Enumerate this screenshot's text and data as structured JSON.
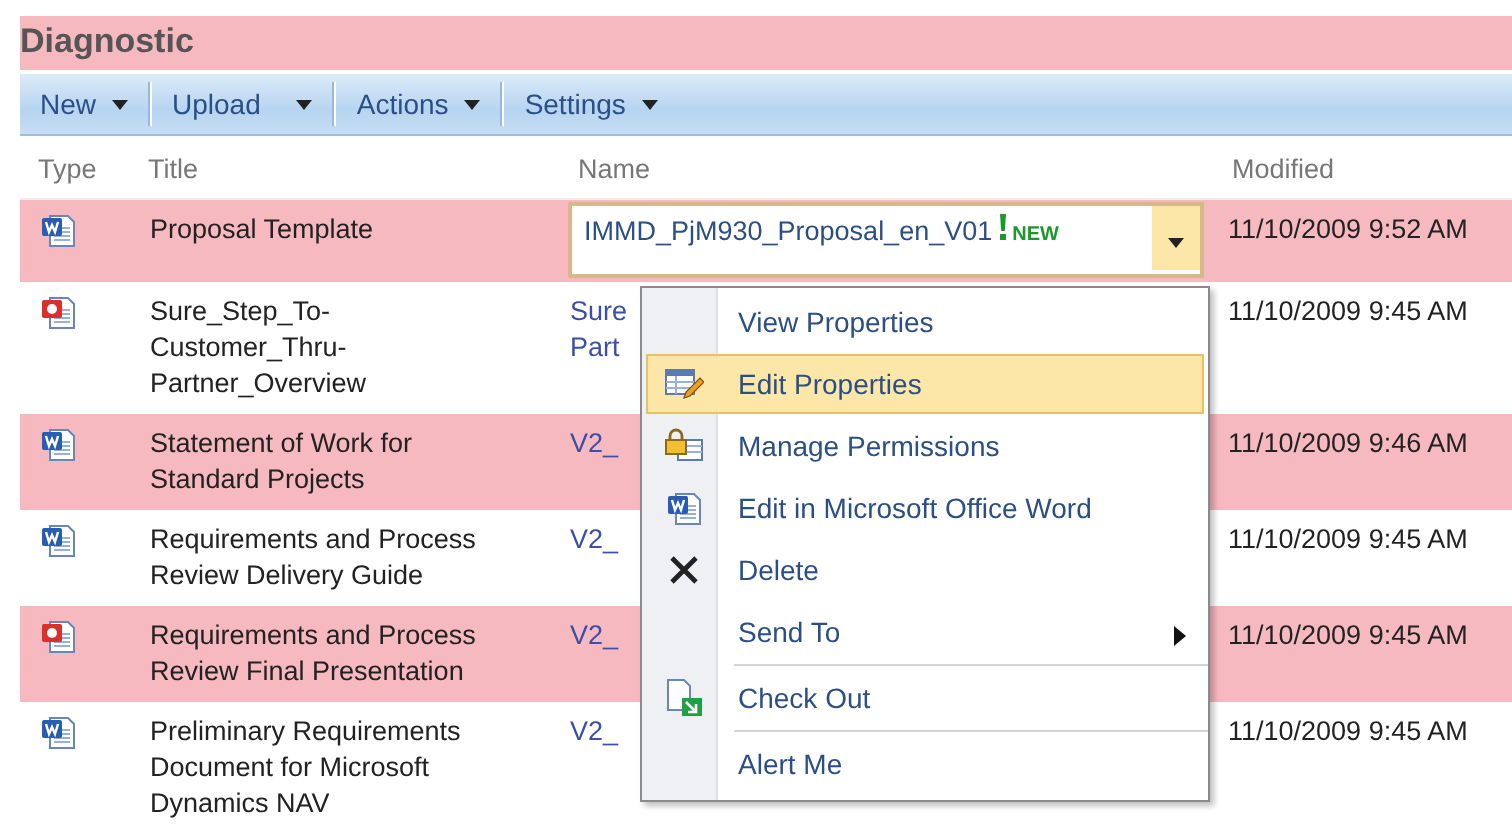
{
  "list_title": "Diagnostic",
  "toolbar": [
    {
      "label": "New"
    },
    {
      "label": "Upload"
    },
    {
      "label": "Actions"
    },
    {
      "label": "Settings"
    }
  ],
  "columns": [
    "Type",
    "Title",
    "Name",
    "Modified"
  ],
  "rows": [
    {
      "kind": "word",
      "title": "Proposal Template",
      "name": "IMMD_PjM930_Proposal_en_V01",
      "badge": "NEW",
      "selected": true,
      "modified": "11/10/2009 9:52 AM"
    },
    {
      "kind": "powerpoint",
      "title": "Sure_Step_To-Customer_Thru-Partner_Overview",
      "name": "Sure Part",
      "selected": false,
      "modified": "11/10/2009 9:45 AM"
    },
    {
      "kind": "word",
      "title": "Statement of Work for Standard Projects",
      "name": "V2_",
      "selected": false,
      "modified": "11/10/2009 9:46 AM"
    },
    {
      "kind": "word",
      "title": "Requirements and Process Review Delivery Guide",
      "name": "V2_",
      "selected": false,
      "modified": "11/10/2009 9:45 AM"
    },
    {
      "kind": "powerpoint",
      "title": "Requirements and Process Review Final Presentation",
      "name": "V2_",
      "selected": false,
      "modified": "11/10/2009 9:45 AM"
    },
    {
      "kind": "word",
      "title": "Preliminary Requirements Document for Microsoft Dynamics NAV",
      "name": "V2_",
      "selected": false,
      "modified": "11/10/2009 9:45 AM"
    }
  ],
  "menu": {
    "items": [
      {
        "kind": "plain",
        "label": "View Properties",
        "selected": false,
        "separator_before": false
      },
      {
        "kind": "edit",
        "label": "Edit Properties",
        "selected": true,
        "separator_before": false
      },
      {
        "kind": "permissions",
        "label": "Manage Permissions",
        "selected": false,
        "separator_before": false
      },
      {
        "kind": "word",
        "label": "Edit in Microsoft Office Word",
        "selected": false,
        "separator_before": false
      },
      {
        "kind": "delete",
        "label": "Delete",
        "selected": false,
        "separator_before": false
      },
      {
        "kind": "submenu",
        "label": "Send To",
        "selected": false,
        "separator_before": false
      },
      {
        "kind": "checkout",
        "label": "Check Out",
        "selected": false,
        "separator_before": true
      },
      {
        "kind": "plain",
        "label": "Alert Me",
        "selected": false,
        "separator_before": true
      }
    ]
  }
}
